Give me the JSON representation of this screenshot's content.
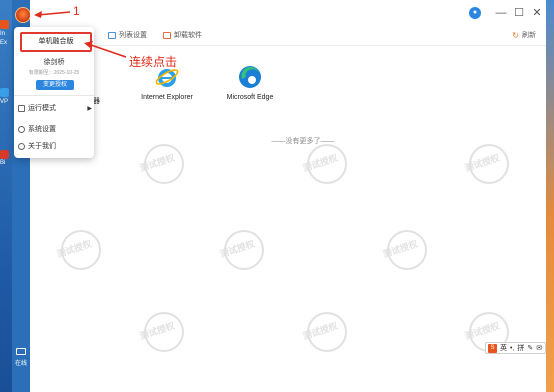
{
  "desktop": {
    "left_labels": [
      "In",
      "Ex",
      "VP",
      "Bi"
    ],
    "status_label": "在线"
  },
  "window": {
    "controls": {
      "minimize": "—",
      "maximize": "☐",
      "close": "✕"
    },
    "avatar_icon": "user-icon"
  },
  "toolbar": {
    "list_settings": "列表设置",
    "uninstall": "卸载软件",
    "refresh": "刷新"
  },
  "apps": [
    {
      "name": "Internet Explorer",
      "icon": "ie-icon"
    },
    {
      "name": "Microsoft Edge",
      "icon": "edge-icon"
    }
  ],
  "partial_app_label": "器",
  "empty_hint": "——没有更多了——",
  "watermark_text": "测试授权",
  "menu": {
    "version": "单机融合版",
    "username": "徐剑桥",
    "expiry": "有限期至：2025-10-25",
    "change_auth": "变更授权",
    "items": [
      {
        "label": "运行模式",
        "icon": "mode-icon",
        "has_submenu": true
      },
      {
        "label": "系统设置",
        "icon": "gear-icon",
        "has_submenu": false
      },
      {
        "label": "关于我们",
        "icon": "info-icon",
        "has_submenu": false
      }
    ]
  },
  "annotations": {
    "step_number": "1",
    "instruction": "连续点击"
  },
  "tray": {
    "logo": "S",
    "lang": "英",
    "items": [
      "•,",
      "拼",
      "✎",
      "✉"
    ]
  },
  "colors": {
    "accent": "#2b86e0",
    "annotation": "#e02a1a",
    "sidebar": "#2a6fb8"
  }
}
